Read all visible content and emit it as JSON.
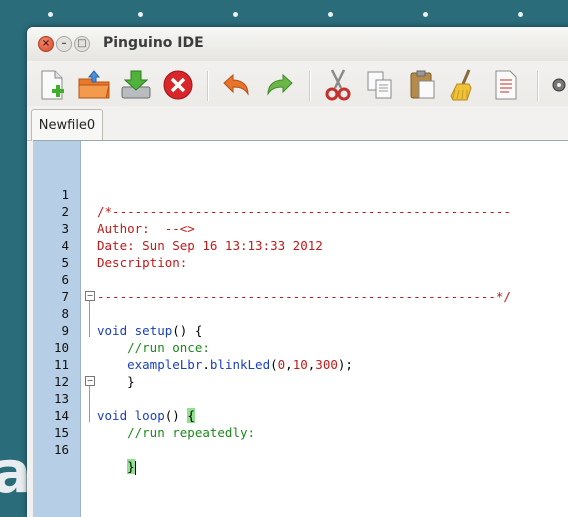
{
  "window": {
    "title": "Pinguino IDE"
  },
  "toolbar": {
    "icons": [
      "new-file-icon",
      "open-folder-icon",
      "save-icon",
      "stop-icon",
      "undo-icon",
      "redo-icon",
      "cut-icon",
      "copy-icon",
      "paste-icon",
      "clear-icon",
      "document-icon",
      "plugin-icon"
    ]
  },
  "tabs": [
    {
      "label": "Newfile0"
    }
  ],
  "editor": {
    "lines": [
      {
        "num": "1",
        "text": "/*-----------------------------------------------------"
      },
      {
        "num": "2",
        "text": "Author:  --<>"
      },
      {
        "num": "3",
        "text": "Date: Sun Sep 16 13:13:33 2012"
      },
      {
        "num": "4",
        "text": "Description:"
      },
      {
        "num": "5",
        "text": ""
      },
      {
        "num": "6",
        "text": "-----------------------------------------------------*/"
      },
      {
        "num": "7",
        "text": ""
      },
      {
        "num": "8",
        "text": "void setup() {"
      },
      {
        "num": "9",
        "text": "    //run once:"
      },
      {
        "num": "10",
        "text": "    exampleLbr.blinkLed(0,10,300);"
      },
      {
        "num": "11",
        "text": "    }"
      },
      {
        "num": "12",
        "text": ""
      },
      {
        "num": "13",
        "text": "void loop() {"
      },
      {
        "num": "14",
        "text": "    //run repeatedly:"
      },
      {
        "num": "15",
        "text": ""
      },
      {
        "num": "16",
        "text": "    }"
      }
    ],
    "tokens": {
      "l8_kw": "void",
      "l8_fn": "setup",
      "l8_rest": "() {",
      "l9": "    //run once:",
      "l10_obj": "    exampleLbr",
      "l10_dot": ".",
      "l10_fn": "blinkLed",
      "l10_p1": "(",
      "l10_n1": "0",
      "l10_c1": ",",
      "l10_n2": "10",
      "l10_c2": ",",
      "l10_n3": "300",
      "l10_end": ");",
      "l11": "    }",
      "l13_kw": "void",
      "l13_fn": "loop",
      "l13_rest": "() ",
      "l13_brace": "{",
      "l14": "    //run repeatedly:",
      "l16_pre": "    ",
      "l16_brace": "}"
    }
  },
  "background": {
    "partial_text": "a"
  },
  "colors": {
    "gutter": "#b6cfe6",
    "comment": "#c21a1a",
    "keyword": "#1a3fbf",
    "green_comment": "#1a8a1a",
    "desktop": "#2b6c7b"
  }
}
